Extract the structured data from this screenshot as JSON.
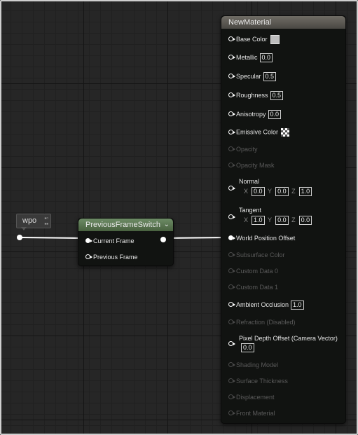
{
  "reroute": {
    "label": "wpo"
  },
  "switch_node": {
    "title": "PreviousFrameSwitch",
    "pins": [
      "Current Frame",
      "Previous Frame"
    ]
  },
  "material_node": {
    "title": "NewMaterial",
    "metallic": "0.0",
    "specular": "0.5",
    "roughness": "0.5",
    "anisotropy": "0.0",
    "normal": {
      "x": "0.0",
      "y": "0.0",
      "z": "1.0"
    },
    "tangent": {
      "x": "1.0",
      "y": "0.0",
      "z": "0.0"
    },
    "ambient_occlusion": "1.0",
    "pixel_depth_offset": "0.0",
    "labels": {
      "base_color": "Base Color",
      "metallic": "Metallic",
      "specular": "Specular",
      "roughness": "Roughness",
      "anisotropy": "Anisotropy",
      "emissive": "Emissive Color",
      "opacity": "Opacity",
      "opacity_mask": "Opacity Mask",
      "normal": "Normal",
      "tangent": "Tangent",
      "wpo": "World Position Offset",
      "subsurface": "Subsurface Color",
      "custom0": "Custom Data 0",
      "custom1": "Custom Data 1",
      "ao": "Ambient Occlusion",
      "refraction": "Refraction (Disabled)",
      "pdo": "Pixel Depth Offset (Camera Vector)",
      "shading": "Shading Model",
      "thickness": "Surface Thickness",
      "displacement": "Displacement",
      "front": "Front Material"
    },
    "axes": {
      "x": "X",
      "y": "Y",
      "z": "Z"
    }
  }
}
